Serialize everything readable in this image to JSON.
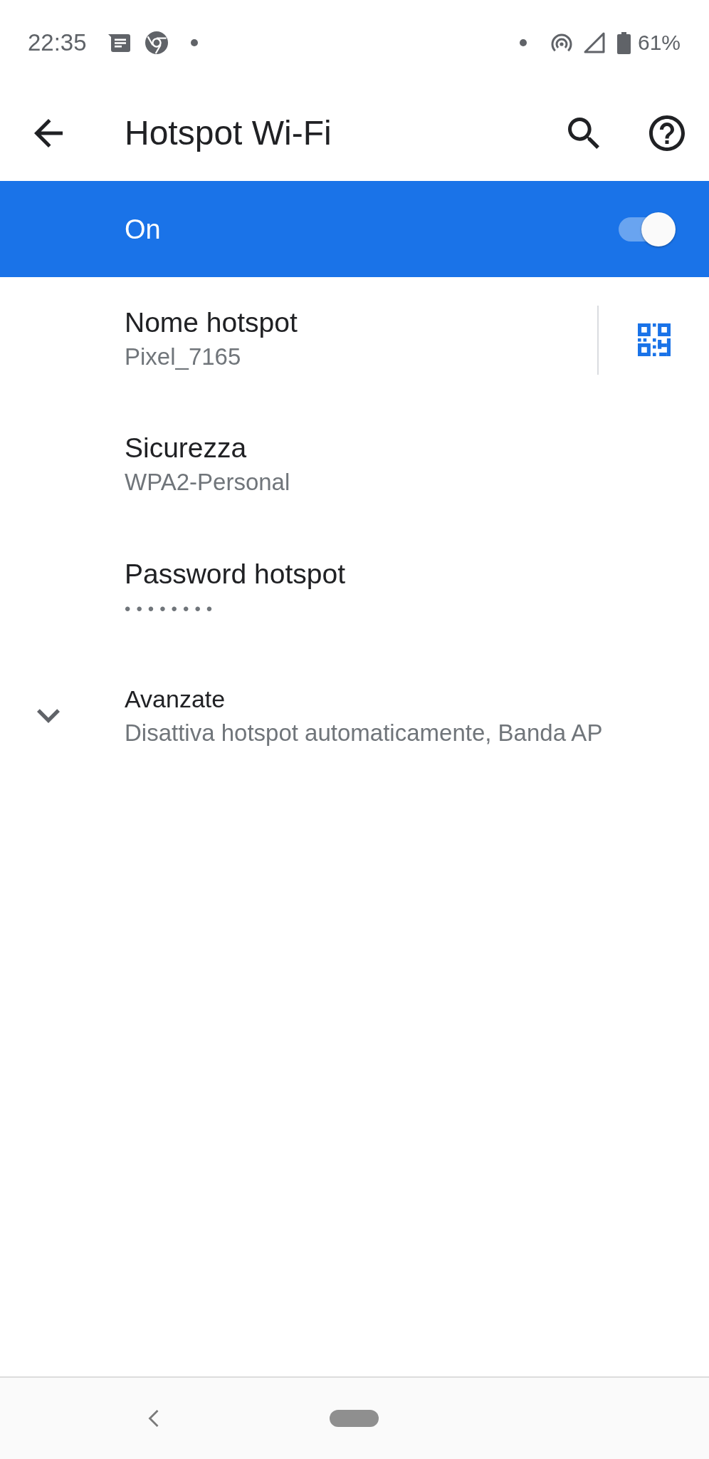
{
  "status_bar": {
    "time": "22:35",
    "battery": "61%"
  },
  "toolbar": {
    "title": "Hotspot Wi-Fi"
  },
  "master_switch": {
    "label": "On",
    "on": true
  },
  "settings": [
    {
      "kind": "qr",
      "title": "Nome hotspot",
      "summary": "Pixel_7165"
    },
    {
      "kind": "text",
      "title": "Sicurezza",
      "summary": "WPA2-Personal"
    },
    {
      "kind": "password",
      "title": "Password hotspot",
      "summary": "••••••••"
    },
    {
      "kind": "expandable",
      "title": "Avanzate",
      "summary": "Disattiva hotspot automaticamente, Banda AP",
      "expanded": false
    }
  ]
}
